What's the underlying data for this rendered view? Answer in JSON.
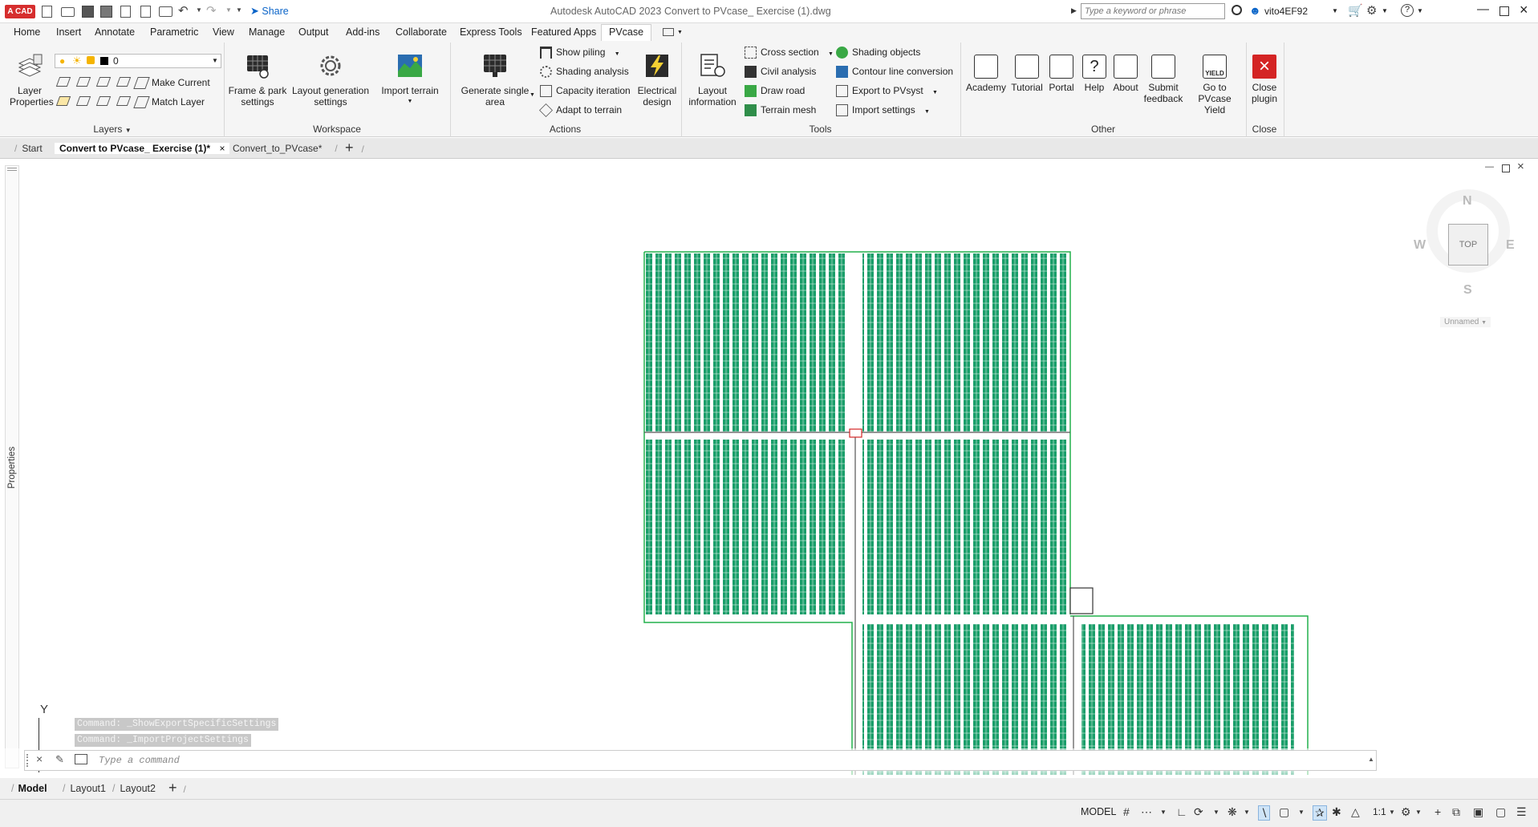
{
  "app": {
    "logo_text": "A CAD",
    "share_label": "Share",
    "title_left": "Autodesk AutoCAD 2023",
    "title_right": "Convert to PVcase_ Exercise (1).dwg",
    "search_placeholder": "Type a keyword or phrase",
    "user_name": "vito4EF92"
  },
  "ribbon_tabs": [
    "Home",
    "Insert",
    "Annotate",
    "Parametric",
    "View",
    "Manage",
    "Output",
    "Add-ins",
    "Collaborate",
    "Express Tools",
    "Featured Apps",
    "PVcase"
  ],
  "layers": {
    "layer_properties": "Layer Properties",
    "current_layer": "0",
    "make_current": "Make Current",
    "match_layer": "Match Layer",
    "panel": "Layers"
  },
  "workspace": {
    "frame_park": "Frame & park settings",
    "layout_generation": "Layout generation settings",
    "import_terrain": "Import terrain",
    "panel": "Workspace"
  },
  "actions": {
    "generate_single_area": "Generate single area",
    "show_piling": "Show piling",
    "shading_analysis": "Shading analysis",
    "capacity_iteration": "Capacity iteration",
    "adapt_to_terrain": "Adapt to terrain",
    "electrical_design": "Electrical design",
    "panel": "Actions"
  },
  "tools": {
    "layout_information": "Layout information",
    "cross_section": "Cross section",
    "civil_analysis": "Civil analysis",
    "draw_road": "Draw road",
    "terrain_mesh": "Terrain mesh",
    "shading_objects": "Shading objects",
    "contour_line_conversion": "Contour line conversion",
    "export_to_pvsyst": "Export to PVsyst",
    "import_settings": "Import settings",
    "panel": "Tools"
  },
  "other": {
    "academy": "Academy",
    "tutorial": "Tutorial",
    "portal": "Portal",
    "help": "Help",
    "about": "About",
    "submit_feedback": "Submit feedback",
    "go_to_yield": "Go to PVcase Yield",
    "yield_icon_text": "YIELD",
    "panel": "Other"
  },
  "close": {
    "close_plugin": "Close plugin",
    "panel": "Close"
  },
  "doc_tabs": [
    "Start",
    "Convert to PVcase_ Exercise (1)*",
    "Convert_to_PVcase*"
  ],
  "viewcube": {
    "n": "N",
    "s": "S",
    "e": "E",
    "w": "W",
    "top": "TOP",
    "unnamed": "Unnamed"
  },
  "properties_label": "Properties",
  "ucs_y": "Y",
  "command": {
    "history": [
      "Command: _ShowExportSpecificSettings",
      "Command: _ImportProjectSettings"
    ],
    "placeholder": "Type a command"
  },
  "layout_tabs": [
    "Model",
    "Layout1",
    "Layout2"
  ],
  "status": {
    "model": "MODEL",
    "scale": "1:1"
  },
  "colors": {
    "accent_blue": "#0696d7",
    "pv_green": "#1a9e6a",
    "boundary_green": "#22b04b",
    "close_red": "#d42424"
  }
}
